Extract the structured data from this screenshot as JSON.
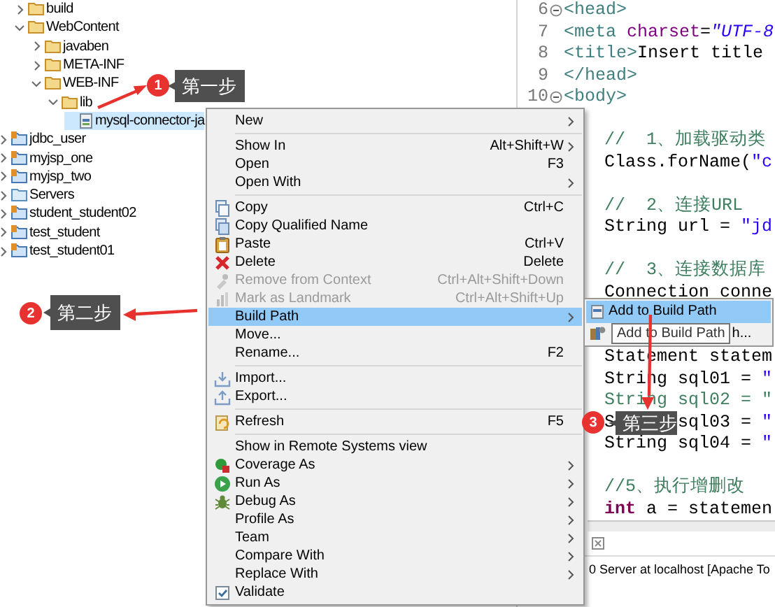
{
  "project_explorer": {
    "tree": {
      "continued_items": [
        {
          "label": "build",
          "kind": "folder",
          "expanded": false,
          "selected": false
        },
        {
          "label": "WebContent",
          "kind": "folder",
          "expanded": true,
          "selected": false,
          "children": [
            {
              "label": "javaben",
              "kind": "folder",
              "expanded": false,
              "selected": false
            },
            {
              "label": "META-INF",
              "kind": "folder",
              "expanded": false,
              "selected": false
            },
            {
              "label": "WEB-INF",
              "kind": "folder",
              "expanded": true,
              "selected": false,
              "children": [
                {
                  "label": "lib",
                  "kind": "folder",
                  "expanded": true,
                  "selected": false,
                  "children": [
                    {
                      "label": "mysql-connector-ja",
                      "kind": "jar",
                      "selected": true
                    }
                  ]
                }
              ]
            }
          ]
        }
      ],
      "projects": [
        {
          "label": "jdbc_user",
          "kind": "project",
          "expanded": false,
          "selected": false
        },
        {
          "label": "myjsp_one",
          "kind": "project",
          "expanded": false,
          "selected": false
        },
        {
          "label": "myjsp_two",
          "kind": "project",
          "expanded": false,
          "selected": false
        },
        {
          "label": "Servers",
          "kind": "server-folder",
          "expanded": false,
          "selected": false
        },
        {
          "label": "student_student02",
          "kind": "project",
          "expanded": false,
          "selected": false
        },
        {
          "label": "test_student",
          "kind": "project",
          "expanded": false,
          "selected": false
        },
        {
          "label": "test_student01",
          "kind": "project",
          "expanded": false,
          "selected": false
        }
      ]
    }
  },
  "editor": {
    "code_blocks": [
      {
        "lines": [
          {
            "number": "6",
            "fold_marker": true,
            "segments": [
              {
                "kind": "tag",
                "text": "<head>"
              }
            ]
          },
          {
            "number": "7",
            "fold_marker": false,
            "segments": [
              {
                "kind": "tag",
                "text": "<meta "
              },
              {
                "kind": "attr",
                "text": "charset"
              },
              {
                "kind": "plain",
                "text": "="
              },
              {
                "kind": "value",
                "text": "\"UTF-8"
              }
            ]
          },
          {
            "number": "8",
            "fold_marker": false,
            "segments": [
              {
                "kind": "tag",
                "text": "<title>"
              },
              {
                "kind": "plain",
                "text": "Insert title"
              }
            ]
          },
          {
            "number": "9",
            "fold_marker": false,
            "segments": [
              {
                "kind": "tag",
                "text": "</head>"
              }
            ]
          },
          {
            "number": "10",
            "fold_marker": true,
            "segments": [
              {
                "kind": "tag",
                "text": "<body>"
              }
            ]
          }
        ]
      },
      {
        "lines": [
          {
            "segments": [
              {
                "kind": "comment",
                "text": "//  1、加载驱动类"
              }
            ]
          },
          {
            "segments": [
              {
                "kind": "plain",
                "text": "Class.forName("
              },
              {
                "kind": "string",
                "text": "\"c"
              }
            ]
          }
        ]
      },
      {
        "lines": [
          {
            "segments": [
              {
                "kind": "comment",
                "text": "//  2、连接URL"
              }
            ]
          },
          {
            "segments": [
              {
                "kind": "plain",
                "text": "String url = "
              },
              {
                "kind": "string",
                "text": "\"jd"
              }
            ]
          }
        ]
      },
      {
        "lines": [
          {
            "segments": [
              {
                "kind": "comment",
                "text": "//  3、连接数据库"
              }
            ]
          },
          {
            "segments": [
              {
                "kind": "plain",
                "text": "Connection conne"
              }
            ]
          }
        ]
      },
      {
        "lines": [
          {
            "segments": [
              {
                "kind": "plain",
                "text": "Statement statem"
              }
            ]
          },
          {
            "segments": [
              {
                "kind": "plain",
                "text": "String sql01 = "
              },
              {
                "kind": "string",
                "text": "\""
              }
            ]
          },
          {
            "segments": [
              {
                "kind": "comment",
                "text": "String sql02 = \""
              }
            ]
          },
          {
            "segments": [
              {
                "kind": "plain",
                "text": "S"
              },
              {
                "kind": "plain",
                "text": "sql03 = ",
                "after_cover": true
              },
              {
                "kind": "string",
                "text": "\""
              }
            ]
          },
          {
            "segments": [
              {
                "kind": "plain",
                "text": "String sql04 = "
              },
              {
                "kind": "string",
                "text": "\""
              }
            ]
          }
        ]
      },
      {
        "lines": [
          {
            "segments": [
              {
                "kind": "comment",
                "text": "//5、执行增删改"
              }
            ]
          },
          {
            "segments": [
              {
                "kind": "keyword",
                "text": "int"
              },
              {
                "kind": "plain",
                "text": " a = statemen"
              }
            ]
          }
        ]
      }
    ]
  },
  "console": {
    "text": "0 Server at localhost [Apache To"
  },
  "context_menu": {
    "groups": [
      [
        {
          "label": "New",
          "submenu": true,
          "disabled": false,
          "selected": false
        }
      ],
      [
        {
          "label": "Show In",
          "shortcut": "Alt+Shift+W",
          "submenu": true,
          "disabled": false,
          "selected": false
        },
        {
          "label": "Open",
          "shortcut": "F3",
          "submenu": false,
          "disabled": false,
          "selected": false
        },
        {
          "label": "Open With",
          "submenu": true,
          "disabled": false,
          "selected": false
        }
      ],
      [
        {
          "label": "Copy",
          "shortcut": "Ctrl+C",
          "submenu": false,
          "disabled": false,
          "selected": false
        },
        {
          "label": "Copy Qualified Name",
          "submenu": false,
          "disabled": false,
          "selected": false
        },
        {
          "label": "Paste",
          "shortcut": "Ctrl+V",
          "submenu": false,
          "disabled": false,
          "selected": false
        },
        {
          "label": "Delete",
          "shortcut": "Delete",
          "submenu": false,
          "disabled": false,
          "selected": false
        },
        {
          "label": "Remove from Context",
          "shortcut": "Ctrl+Alt+Shift+Down",
          "submenu": false,
          "disabled": true,
          "selected": false
        },
        {
          "label": "Mark as Landmark",
          "shortcut": "Ctrl+Alt+Shift+Up",
          "submenu": false,
          "disabled": true,
          "selected": false
        },
        {
          "label": "Build Path",
          "submenu": true,
          "disabled": false,
          "selected": true
        },
        {
          "label": "Move...",
          "submenu": false,
          "disabled": false,
          "selected": false
        },
        {
          "label": "Rename...",
          "shortcut": "F2",
          "submenu": false,
          "disabled": false,
          "selected": false
        }
      ],
      [
        {
          "label": "Import...",
          "submenu": false,
          "disabled": false,
          "selected": false
        },
        {
          "label": "Export...",
          "submenu": false,
          "disabled": false,
          "selected": false
        }
      ],
      [
        {
          "label": "Refresh",
          "shortcut": "F5",
          "submenu": false,
          "disabled": false,
          "selected": false
        }
      ],
      [
        {
          "label": "Show in Remote Systems view",
          "submenu": false,
          "disabled": false,
          "selected": false
        },
        {
          "label": "Coverage As",
          "submenu": true,
          "disabled": false,
          "selected": false
        },
        {
          "label": "Run As",
          "submenu": true,
          "disabled": false,
          "selected": false
        },
        {
          "label": "Debug As",
          "submenu": true,
          "disabled": false,
          "selected": false
        },
        {
          "label": "Profile As",
          "submenu": true,
          "disabled": false,
          "selected": false
        },
        {
          "label": "Team",
          "submenu": true,
          "disabled": false,
          "selected": false
        },
        {
          "label": "Compare With",
          "submenu": true,
          "disabled": false,
          "selected": false
        },
        {
          "label": "Replace With",
          "submenu": true,
          "disabled": false,
          "selected": false
        },
        {
          "label": "Validate",
          "submenu": false,
          "disabled": false,
          "selected": false
        }
      ]
    ]
  },
  "submenu": {
    "items": [
      {
        "label": "Add to Build Path",
        "selected": true
      },
      {
        "label": "h...",
        "selected": false,
        "tooltip": "Add to Build Path"
      }
    ]
  },
  "annotations": [
    {
      "number": "1",
      "label": "第一步"
    },
    {
      "number": "2",
      "label": "第二步"
    },
    {
      "number": "3",
      "label": "第三步"
    }
  ]
}
